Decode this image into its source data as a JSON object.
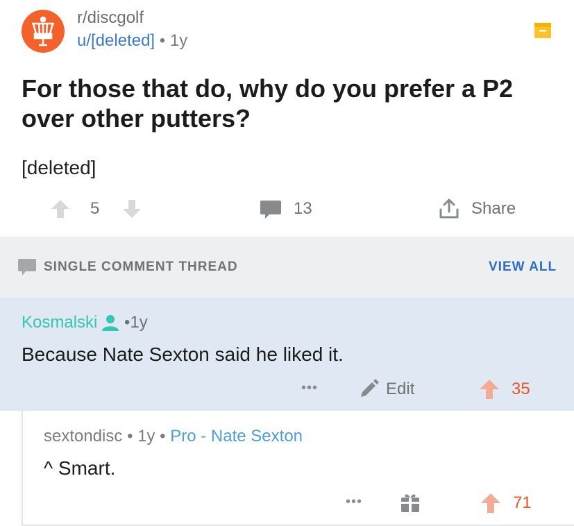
{
  "post": {
    "subreddit": "r/discgolf",
    "author": "u/[deleted]",
    "age": "1y",
    "title": "For those that do, why do you prefer a P2 over other putters?",
    "body": "[deleted]",
    "score": "5",
    "comments": "13",
    "share_label": "Share"
  },
  "thread": {
    "label": "SINGLE COMMENT THREAD",
    "view_all": "VIEW ALL"
  },
  "comments": [
    {
      "author": "Kosmalski",
      "age": "1y",
      "text": "Because Nate Sexton said he liked it.",
      "more": "•••",
      "edit_label": "Edit",
      "score": "35"
    },
    {
      "author": "sextondisc",
      "age": "1y",
      "flair": "Pro - Nate Sexton",
      "text": "^ Smart.",
      "more": "•••",
      "score": "71"
    }
  ],
  "icons": {
    "subreddit": "disc-golf-basket-icon",
    "save": "archive-icon",
    "upvote": "upvote-arrow-icon",
    "downvote": "downvote-arrow-icon",
    "comment": "comment-bubble-icon",
    "share": "share-icon",
    "user": "user-icon",
    "edit": "pencil-icon",
    "gift": "gift-icon"
  },
  "colors": {
    "brand": "#f2622a",
    "link": "#3d7cc9",
    "upvoted": "#e8552a",
    "op_user": "#35c5b5",
    "highlight_bg": "#dfe8f3"
  }
}
